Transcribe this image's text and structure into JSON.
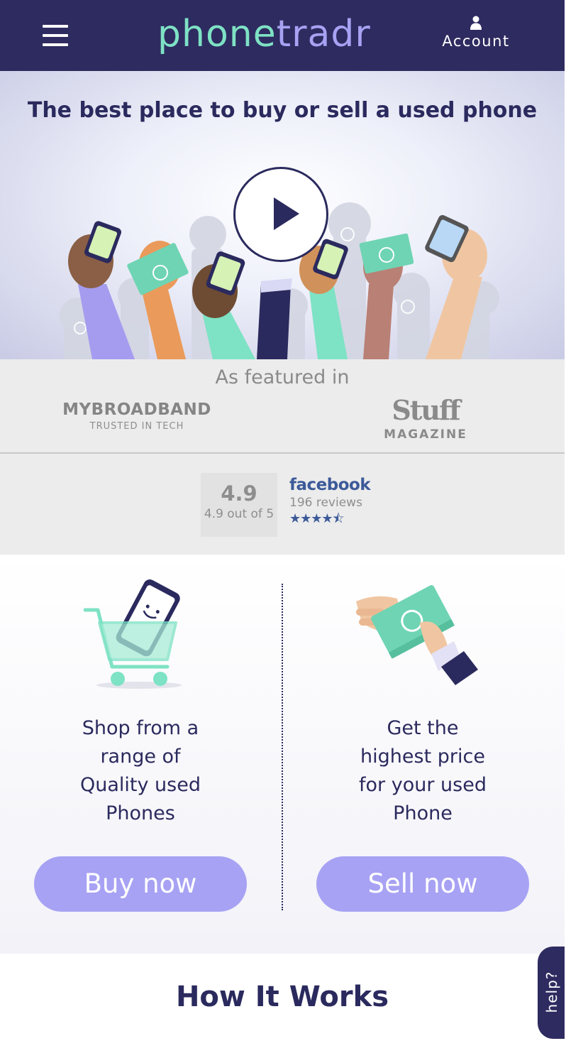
{
  "header": {
    "logo_part1": "phone",
    "logo_part2": "tradr",
    "account_label": "Account"
  },
  "hero": {
    "title": "The best place to buy or sell a used phone"
  },
  "featured": {
    "title": "As featured in",
    "mybroadband_name": "MYBROADBAND",
    "mybroadband_tagline": "TRUSTED IN TECH",
    "stuff_name": "Stuff",
    "stuff_sub": "MAGAZINE"
  },
  "rating": {
    "score": "4.9",
    "out_of": "4.9 out of 5",
    "source": "facebook",
    "reviews": "196 reviews",
    "stars_value": 4.5,
    "stars_display": "★★★★⯪"
  },
  "buy": {
    "lines": [
      "Shop from a",
      "range of",
      "Quality used",
      "Phones"
    ],
    "button": "Buy now"
  },
  "sell": {
    "lines": [
      "Get the",
      "highest price",
      "for your used",
      "Phone"
    ],
    "button": "Sell now"
  },
  "how": {
    "title": "How It Works"
  },
  "help": {
    "label": "help?"
  },
  "colors": {
    "navy": "#2e2b60",
    "mint": "#7ee2c4",
    "lavender": "#a7a2f3",
    "facebook": "#3c5a99"
  },
  "icons": [
    "menu-icon",
    "user-icon",
    "play-icon",
    "shopping-cart-icon",
    "money-hand-icon"
  ]
}
